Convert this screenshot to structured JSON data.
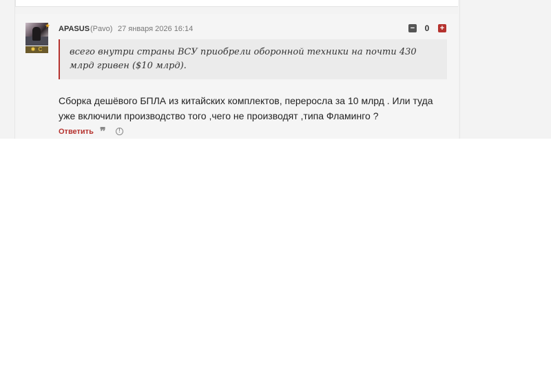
{
  "comment": {
    "author": {
      "username": "APASUS",
      "realname": "(Pavo)",
      "avatar_icon": "avatar-icon",
      "star_icon": "star-icon",
      "star_glyph": "★",
      "rank_badge": "✱ C"
    },
    "timestamp": "27 января 2026 16:14",
    "votes": {
      "minus_glyph": "−",
      "score": "0",
      "plus_glyph": "+"
    },
    "quote": "всего внутри страны ВСУ приобрели оборонной техники на почти 430 млрд гривен ($10 млрд).",
    "body": "Сборка дешёвого БПЛА из китайских комплектов, переросла за 10 млрд . Или туда уже включили производство того ,чего не производят ,типа Фламинго ?",
    "actions": {
      "reply_label": "Ответить",
      "quote_glyph": "❞",
      "report_glyph": "!"
    }
  },
  "colors": {
    "accent": "#b5322e",
    "card_bg": "#f5f5f5",
    "quote_bg": "#ebebeb"
  }
}
